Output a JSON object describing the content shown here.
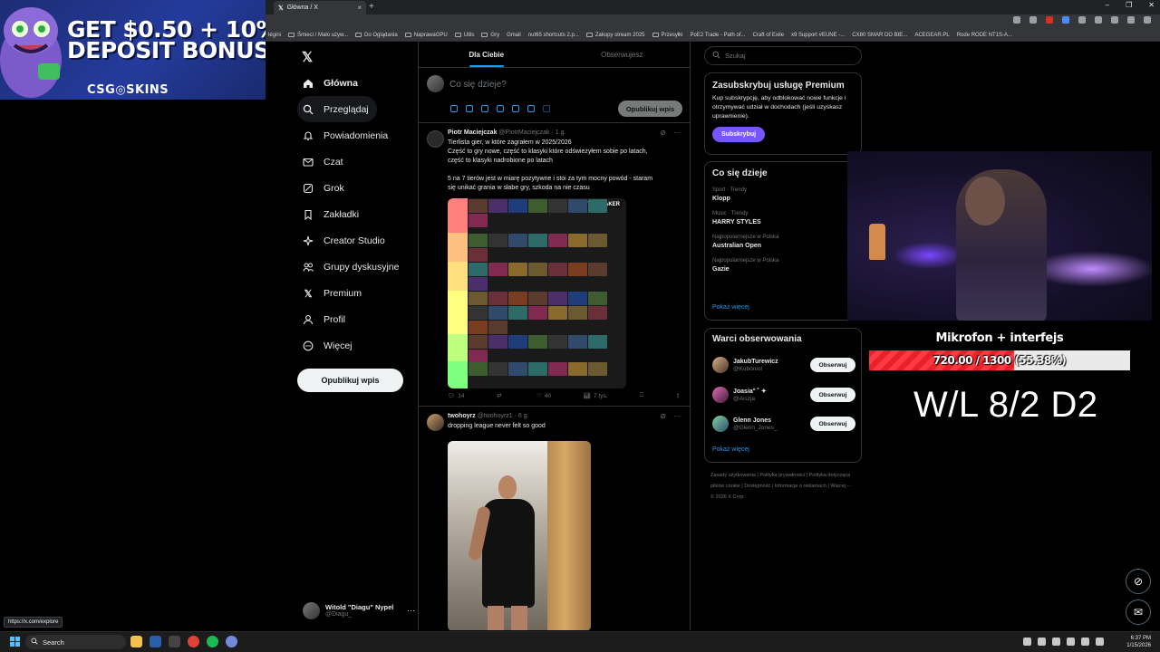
{
  "browser": {
    "tab_title": "Główna / X",
    "tab_close": "×",
    "new_tab": "+",
    "window_controls": [
      "–",
      "❐",
      "✕"
    ],
    "bookmarks": [
      "légini",
      "Śmieci / Mało używ...",
      "Do Oglądania",
      "NaprawaGPU",
      "Utils",
      "Gry",
      "Gmail",
      "nut65 shortcuts 2.p...",
      "Zakupy stream 2025",
      "Przesyłki",
      "PoE2 Trade - Path of...",
      "Craft of Exile",
      "x9 Support #EUNE -...",
      "CX80 SMAR DO BIE...",
      "ACEGEAR.PL",
      "Rode RODE NT1S-A..."
    ],
    "status_url": "https://x.com/explore"
  },
  "ad": {
    "line1": "GET $0.50 + 10%",
    "line2": "DEPOSIT BONUS",
    "brand": "CSG◎SKINS"
  },
  "nav": {
    "logo": "𝕏",
    "items": [
      {
        "label": "Główna",
        "icon": "home-icon"
      },
      {
        "label": "Przeglądaj",
        "icon": "search-icon"
      },
      {
        "label": "Powiadomienia",
        "icon": "bell-icon"
      },
      {
        "label": "Czat",
        "icon": "mail-icon"
      },
      {
        "label": "Grok",
        "icon": "grok-icon"
      },
      {
        "label": "Zakładki",
        "icon": "bookmark-icon"
      },
      {
        "label": "Creator Studio",
        "icon": "creator-icon"
      },
      {
        "label": "Grupy dyskusyjne",
        "icon": "people-icon"
      },
      {
        "label": "Premium",
        "icon": "x-icon"
      },
      {
        "label": "Profil",
        "icon": "person-icon"
      },
      {
        "label": "Więcej",
        "icon": "more-icon"
      }
    ],
    "post_button": "Opublikuj wpis",
    "profile_name": "Witold \"Diagu\" Nypel",
    "profile_handle": "@Diagu_",
    "profile_more": "···"
  },
  "feed": {
    "tabs": [
      "Dla Ciebie",
      "Obserwujesz"
    ],
    "compose_placeholder": "Co się dzieje?",
    "compose_post": "Opublikuj wpis",
    "tweets": [
      {
        "name": "Piotr Maciejczak",
        "handle": "@PiotrMaciejczak · 1 g.",
        "lines": [
          "Tierlista gier, w które zagrałem w 2025/2026",
          "Część to gry nowe, część to klasyki które odświeżyłem sobie po latach,",
          "część to klasyki nadrobione po latach",
          "",
          "5 na 7 tierów jest w miarę pozytywne i stoi za tym mocny powód - staram",
          "się unikać grania w słabe gry, szkoda na nie czasu"
        ],
        "image_logo": "TIERMAKER",
        "replies": "14",
        "reposts": "",
        "likes": "40",
        "views": "7 tys."
      },
      {
        "name": "twohoyrz",
        "handle": "@twohoyrz1 · 6 g.",
        "lines": [
          "dropping league never felt so good"
        ]
      }
    ]
  },
  "right": {
    "search_placeholder": "Szukaj",
    "premium": {
      "title": "Zasubskrybuj usługę Premium",
      "text": "Kup subskrypcję, aby odblokować nowe funkcje i otrzymywać udział w dochodach (jeśli uzyskasz uprawnienie).",
      "button": "Subskrybuj"
    },
    "trends": {
      "title": "Co się dzieje",
      "items": [
        {
          "context": "Sport · Trendy",
          "name": "Klopp"
        },
        {
          "context": "Music · Trendy",
          "name": "HARRY STYLES"
        },
        {
          "context": "Najpopularniejsze w Polska",
          "name": "Australian Open"
        },
        {
          "context": "Najpopularniejsze w Polska",
          "name": "Gazie"
        }
      ],
      "more": "Pokaż więcej"
    },
    "follow": {
      "title": "Warci obserwowania",
      "users": [
        {
          "name": "JakubTurewicz",
          "handle": "@Kuboniol",
          "button": "Obserwuj"
        },
        {
          "name": "Joasia° ˚ ✦",
          "handle": "@Aiszja",
          "button": "Obserwuj"
        },
        {
          "name": "Glenn Jones",
          "handle": "@Glenn_Jones_",
          "button": "Obserwuj"
        }
      ],
      "more": "Pokaż więcej"
    },
    "footer": "Zasady użytkowania | Polityka prywatności | Polityka dotycząca plików cookie | Dostępność | Informacje o reklamach | Więcej ··· © 2026 X Corp."
  },
  "stream": {
    "goal_title": "Mikrofon + interfejs",
    "goal_current": 720,
    "goal_target": 1300,
    "goal_text": "720.00 / 1300 (55.38%)",
    "wl": "W/L 8/2 D2"
  },
  "taskbar": {
    "search": "Search",
    "time": "6:37 PM",
    "date": "1/15/2026"
  },
  "colors": {
    "accent": "#1d9bf0",
    "premium_button": "#7856ff",
    "goal_fill": "#e8202a",
    "background": "#000000",
    "border": "#2f3336"
  }
}
